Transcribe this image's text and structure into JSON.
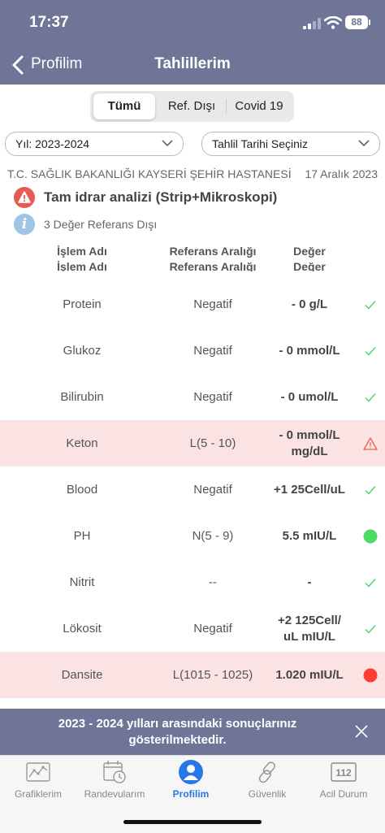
{
  "status_bar": {
    "time": "17:37",
    "battery": "88"
  },
  "nav": {
    "back_label": "Profilim",
    "title": "Tahlillerim"
  },
  "segments": [
    {
      "label": "Tümü",
      "active": true
    },
    {
      "label": "Ref. Dışı",
      "active": false
    },
    {
      "label": "Covid 19",
      "active": false
    }
  ],
  "filters": {
    "year": "Yıl: 2023-2024",
    "date": "Tahlil Tarihi Seçiniz"
  },
  "report": {
    "hospital": "T.C. SAĞLIK BAKANLIĞI KAYSERİ ŞEHİR HASTANESİ",
    "date": "17 Aralık 2023",
    "test_name": "Tam idrar analizi (Strip+Mikroskopi)",
    "out_of_range_note": "3 Değer Referans Dışı",
    "columns": {
      "name": "İşlem Adı",
      "reference": "Referans Aralığı",
      "value": "Değer"
    },
    "rows": [
      {
        "name": "Protein",
        "reference": "Negatif",
        "value": "-     0    g/L",
        "status": "ok",
        "alert": false
      },
      {
        "name": "Glukoz",
        "reference": "Negatif",
        "value": "-     0 mmol/L",
        "status": "ok",
        "alert": false
      },
      {
        "name": "Bilirubin",
        "reference": "Negatif",
        "value": "-     0 umol/L",
        "status": "ok",
        "alert": false
      },
      {
        "name": "Keton",
        "reference": "L(5 - 10)",
        "value": "-     0 mmol/L\nmg/dL",
        "status": "warning",
        "alert": true
      },
      {
        "name": "Blood",
        "reference": "Negatif",
        "value": "+1    25Cell/uL",
        "status": "ok",
        "alert": false
      },
      {
        "name": "PH",
        "reference": "N(5 - 9)",
        "value": "5.5 mIU/L",
        "status": "normal",
        "alert": false
      },
      {
        "name": "Nitrit",
        "reference": "--",
        "value": "-",
        "status": "ok",
        "alert": false
      },
      {
        "name": "Lökosit",
        "reference": "Negatif",
        "value": "+2    125Cell/\nuL mIU/L",
        "status": "ok",
        "alert": false
      },
      {
        "name": "Dansite",
        "reference": "L(1015 - 1025)",
        "value": "1.020 mIU/L",
        "status": "abnormal",
        "alert": true
      }
    ]
  },
  "toast": {
    "text": "2023 - 2024 yılları arasındaki sonuçlarınız gösterilmektedir."
  },
  "tabbar": [
    {
      "label": "Grafiklerim",
      "icon": "chart-icon",
      "active": false
    },
    {
      "label": "Randevularım",
      "icon": "calendar-clock-icon",
      "active": false
    },
    {
      "label": "Profilim",
      "icon": "profile-icon",
      "active": true
    },
    {
      "label": "Güvenlik",
      "icon": "link-icon",
      "active": false
    },
    {
      "label": "Acil Durum",
      "icon": "emergency-112-icon",
      "emergency_number": "112",
      "active": false
    }
  ],
  "colors": {
    "header": "#6e7596",
    "alert_row": "#fbe3e3",
    "ok": "#4cd964",
    "danger": "#ff3b30",
    "warning": "#e85b50",
    "active_tab": "#2877e6"
  }
}
